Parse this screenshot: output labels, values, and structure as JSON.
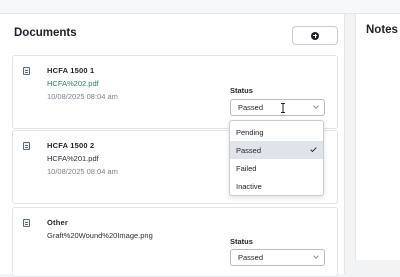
{
  "documents_panel": {
    "title": "Documents",
    "add_button_icon": "plus-circle-icon"
  },
  "notes_panel": {
    "title": "Notes"
  },
  "cards": [
    {
      "title": "HCFA 1500 1",
      "file": "HCFA%202.pdf",
      "date": "10/08/2025 08:04 am",
      "status_label": "Status",
      "status_value": "Passed",
      "icon": "document-icon"
    },
    {
      "title": "HCFA 1500 2",
      "file": "HCFA%201.pdf",
      "date": "10/08/2025 08:04 am",
      "icon": "document-icon"
    },
    {
      "title": "Other",
      "file": "Graft%20Wound%20Image.png",
      "status_label": "Status",
      "status_value": "Passed",
      "icon": "document-icon"
    }
  ],
  "status_dropdown": {
    "options": [
      "Pending",
      "Passed",
      "Failed",
      "Inactive"
    ],
    "selected": "Passed"
  },
  "colors": {
    "link": "#2e7d60",
    "selected_option_bg": "#dfe4ea"
  }
}
